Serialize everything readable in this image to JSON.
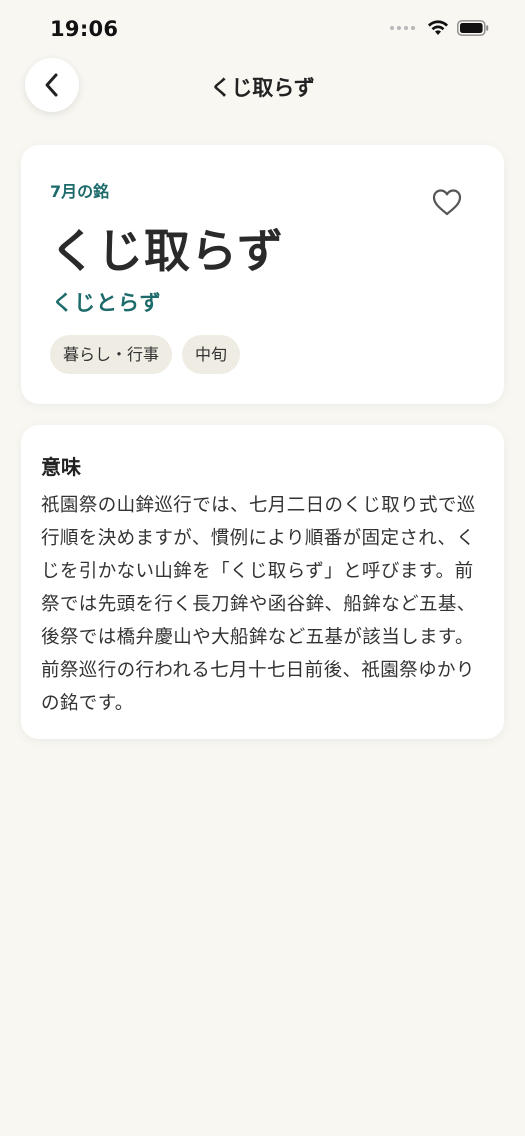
{
  "status_bar": {
    "time": "19:06"
  },
  "nav": {
    "title": "くじ取らず"
  },
  "mei": {
    "month_label": "7月の銘",
    "title": "くじ取らず",
    "reading": "くじとらず",
    "tags": [
      "暮らし・行事",
      "中旬"
    ]
  },
  "meaning": {
    "heading": "意味",
    "body": "祇園祭の山鉾巡行では、七月二日のくじ取り式で巡行順を決めますが、慣例により順番が固定され、くじを引かない山鉾を「くじ取らず」と呼びます。前祭では先頭を行く長刀鉾や函谷鉾、船鉾など五基、後祭では橋弁慶山や大船鉾など五基が該当します。前祭巡行の行われる七月十七日前後、祇園祭ゆかりの銘です。"
  },
  "colors": {
    "accent": "#1e6b6b",
    "background": "#f8f7f2",
    "tag_background": "#efece3"
  },
  "icons": {
    "back": "chevron-left-icon",
    "favorite": "heart-outline-icon",
    "wifi": "wifi-icon",
    "battery": "battery-icon",
    "signal": "signal-dots-icon"
  }
}
